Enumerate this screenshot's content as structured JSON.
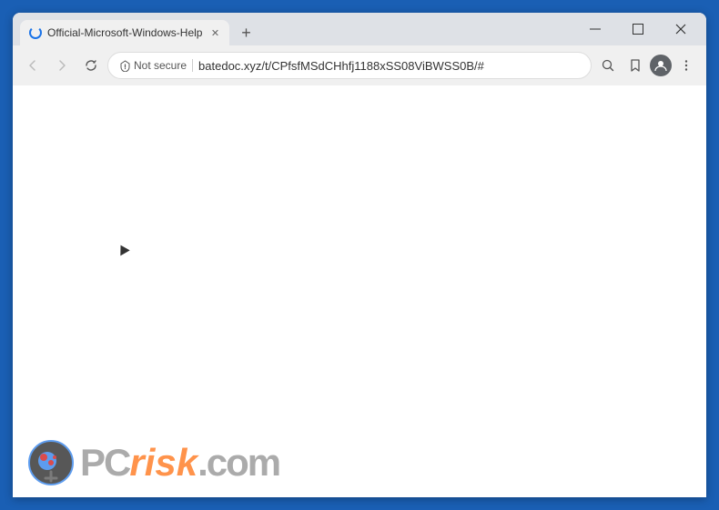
{
  "window": {
    "title": "Official-Microsoft-Windows-Help",
    "tab_label": "Official-Microsoft-Windows-Help",
    "new_tab_tooltip": "New tab"
  },
  "address_bar": {
    "not_secure_label": "Not secure",
    "url": "batedoc.xyz/t/CPfsfMSdCHhfj1188xSS08ViBWSS0B/#"
  },
  "nav": {
    "back_label": "Back",
    "forward_label": "Forward",
    "reload_label": "Stop loading",
    "search_label": "Search",
    "bookmark_label": "Bookmark",
    "profile_label": "Profile",
    "menu_label": "More"
  },
  "controls": {
    "minimize": "Minimize",
    "maximize": "Maximize",
    "close": "Close"
  },
  "watermark": {
    "pc": "PC",
    "risk": "risk",
    "dotcom": ".com"
  }
}
